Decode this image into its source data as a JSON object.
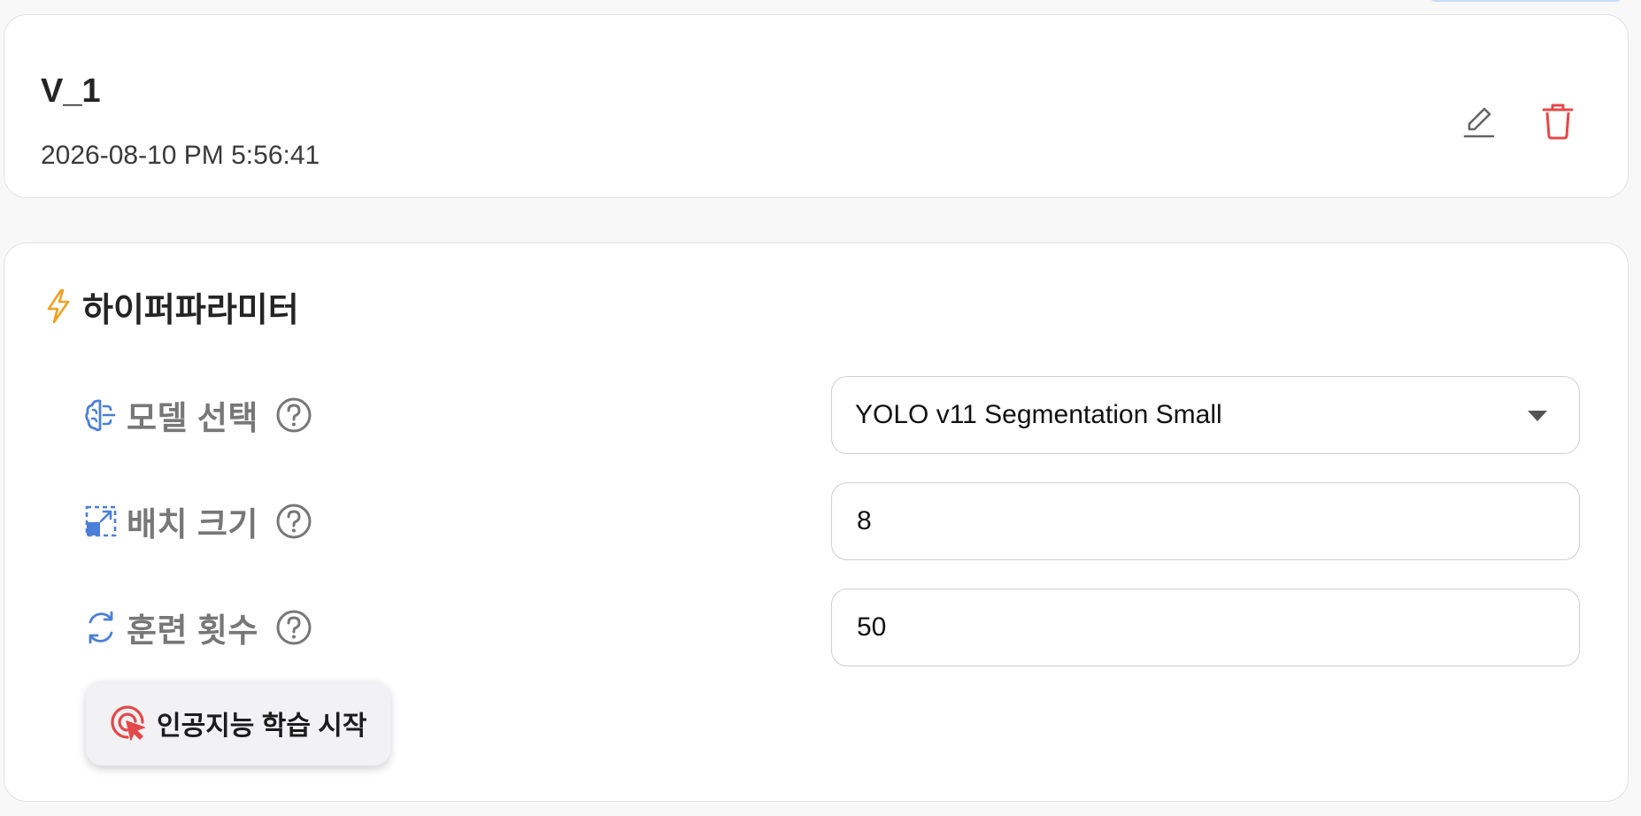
{
  "version": {
    "title": "V_1",
    "timestamp": "2026-08-10 PM 5:56:41",
    "actions": {
      "edit_icon": "pencil-icon",
      "delete_icon": "trash-icon"
    }
  },
  "hyperparameters": {
    "title": "하이퍼파라미터",
    "title_icon": "lightning-icon",
    "fields": [
      {
        "label": "모델 선택",
        "icon": "brain-icon",
        "help_icon": "question-circle-icon",
        "type": "select",
        "value": "YOLO v11 Segmentation Small"
      },
      {
        "label": "배치 크기",
        "icon": "resize-square-icon",
        "help_icon": "question-circle-icon",
        "type": "number",
        "value": "8"
      },
      {
        "label": "훈련 횟수",
        "icon": "refresh-icon",
        "help_icon": "question-circle-icon",
        "type": "number",
        "value": "50"
      }
    ],
    "start_button": {
      "label": "인공지능 학습 시작",
      "icon": "target-cursor-icon"
    }
  },
  "colors": {
    "accent_blue": "#4a7fd8",
    "delete_red": "#e54848",
    "lightning_orange": "#f0a020",
    "label_gray": "#777777"
  }
}
